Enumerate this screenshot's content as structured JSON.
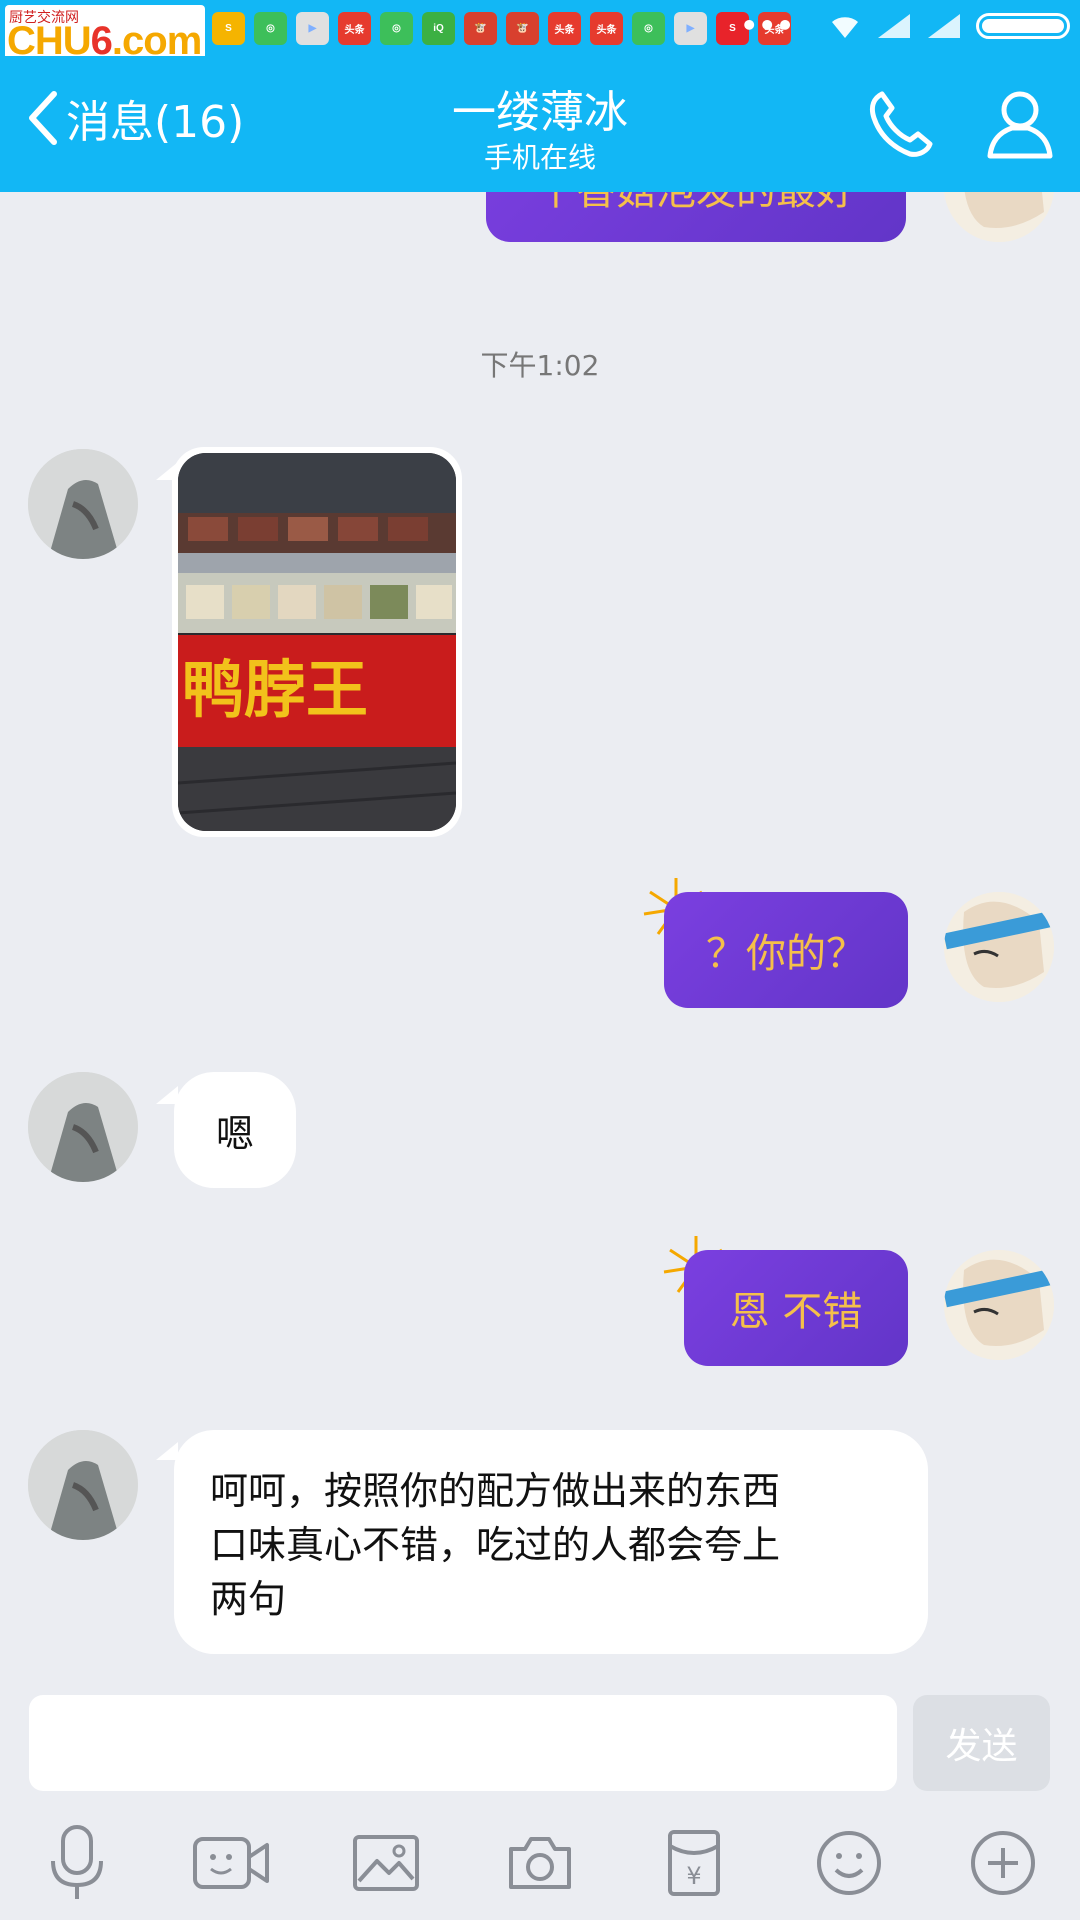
{
  "watermark": {
    "site_name": "厨艺交流网",
    "brand": "CHU6.com"
  },
  "header": {
    "back_label": "消息(16)",
    "contact_name": "一缕薄冰",
    "contact_status": "手机在线"
  },
  "chat": {
    "partial_message": "千香菇泡发的最好",
    "timestamp": "下午1:02",
    "image_sign_text": "鸭脖王",
    "messages": [
      {
        "sender": "other",
        "type": "image"
      },
      {
        "sender": "self",
        "type": "text",
        "text": "？你的？"
      },
      {
        "sender": "other",
        "type": "text",
        "text": "嗯"
      },
      {
        "sender": "self",
        "type": "text",
        "text": "恩 不错"
      },
      {
        "sender": "other",
        "type": "text",
        "lines": [
          "呵呵，按照你的配方做出来的东西",
          "口味真心不错，吃过的人都会夸上",
          "两句"
        ]
      }
    ]
  },
  "input": {
    "placeholder": "",
    "send_label": "发送"
  },
  "toolbar": [
    "mic-icon",
    "video-icon",
    "image-icon",
    "camera-icon",
    "red-packet-icon",
    "emoji-icon",
    "plus-icon"
  ],
  "colors": {
    "header": "#12b7f5",
    "self_bubble": "#6a38d0",
    "self_text": "#f5c04a",
    "background": "#ebedf2"
  }
}
